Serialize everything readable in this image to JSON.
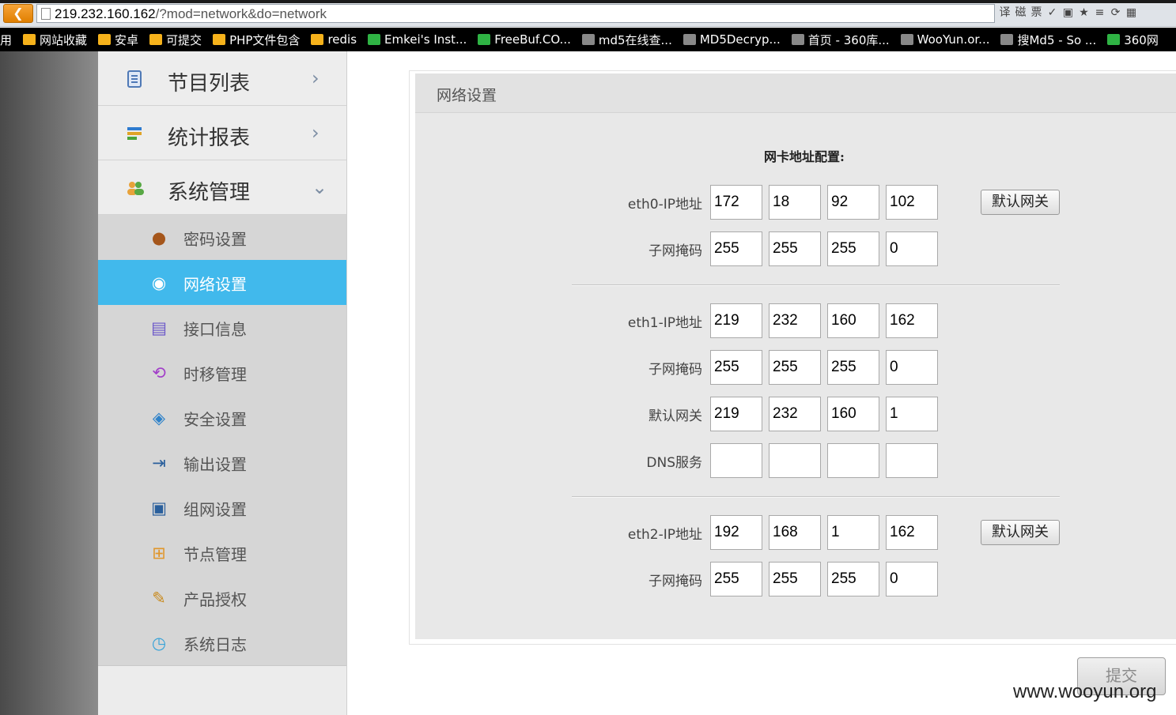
{
  "browser": {
    "url_host": "219.232.160.162",
    "url_path": "/?mod=network&do=network",
    "bookmarks": [
      {
        "label": "用",
        "icon": "partial-label"
      },
      {
        "label": "网站收藏",
        "icon": "folder-icon"
      },
      {
        "label": "安卓",
        "icon": "folder-icon"
      },
      {
        "label": "可提交",
        "icon": "folder-icon"
      },
      {
        "label": "PHP文件包含",
        "icon": "folder-icon"
      },
      {
        "label": "redis",
        "icon": "folder-icon"
      },
      {
        "label": "Emkei's Inst...",
        "icon": "green-icon"
      },
      {
        "label": "FreeBuf.CO...",
        "icon": "freebuf-icon"
      },
      {
        "label": "md5在线查...",
        "icon": "grid-icon"
      },
      {
        "label": "MD5Decryp...",
        "icon": "site-icon"
      },
      {
        "label": "首页 - 360库...",
        "icon": "star-icon"
      },
      {
        "label": "WooYun.or...",
        "icon": "cloud-icon"
      },
      {
        "label": "搜Md5 - So ...",
        "icon": "md5-icon"
      },
      {
        "label": "360网",
        "icon": "shield-icon"
      }
    ],
    "toolbar_icons": [
      "译",
      "磁",
      "票",
      "✓",
      "▣",
      "★",
      "≡",
      "⟳",
      "▦"
    ]
  },
  "sidebar": {
    "main_menus": [
      {
        "label": "节目列表",
        "arrow": "›",
        "icon": "list-icon"
      },
      {
        "label": "统计报表",
        "arrow": "›",
        "icon": "report-icon"
      },
      {
        "label": "系统管理",
        "arrow": "⌄",
        "icon": "users-icon"
      }
    ],
    "sub_items": [
      {
        "label": "密码设置",
        "icon": "user-icon",
        "glyph": "👤"
      },
      {
        "label": "网络设置",
        "icon": "globe-icon",
        "glyph": "◍"
      },
      {
        "label": "接口信息",
        "icon": "interface-icon",
        "glyph": "▤"
      },
      {
        "label": "时移管理",
        "icon": "timeshift-icon",
        "glyph": "⟲"
      },
      {
        "label": "安全设置",
        "icon": "shield-icon",
        "glyph": "◈"
      },
      {
        "label": "输出设置",
        "icon": "export-icon",
        "glyph": "⇥"
      },
      {
        "label": "组网设置",
        "icon": "network-icon",
        "glyph": "▣"
      },
      {
        "label": "节点管理",
        "icon": "node-icon",
        "glyph": "⊞"
      },
      {
        "label": "产品授权",
        "icon": "license-icon",
        "glyph": "✎"
      },
      {
        "label": "系统日志",
        "icon": "clock-icon",
        "glyph": "◷"
      }
    ],
    "active_index": 1
  },
  "panel": {
    "title": "网络设置",
    "section_title": "网卡地址配置:",
    "gateway_button": "默认网关",
    "eth0": {
      "ip_label": "eth0-IP地址",
      "ip": [
        "172",
        "18",
        "92",
        "102"
      ],
      "mask_label": "子网掩码",
      "mask": [
        "255",
        "255",
        "255",
        "0"
      ]
    },
    "eth1": {
      "ip_label": "eth1-IP地址",
      "ip": [
        "219",
        "232",
        "160",
        "162"
      ],
      "mask_label": "子网掩码",
      "mask": [
        "255",
        "255",
        "255",
        "0"
      ],
      "gateway_label": "默认网关",
      "gateway": [
        "219",
        "232",
        "160",
        "1"
      ],
      "dns_label": "DNS服务",
      "dns": [
        "",
        "",
        "",
        ""
      ]
    },
    "eth2": {
      "ip_label": "eth2-IP地址",
      "ip": [
        "192",
        "168",
        "1",
        "162"
      ],
      "mask_label": "子网掩码",
      "mask": [
        "255",
        "255",
        "255",
        "0"
      ]
    }
  },
  "submit_label": "提交",
  "watermark": "www.wooyun.org"
}
